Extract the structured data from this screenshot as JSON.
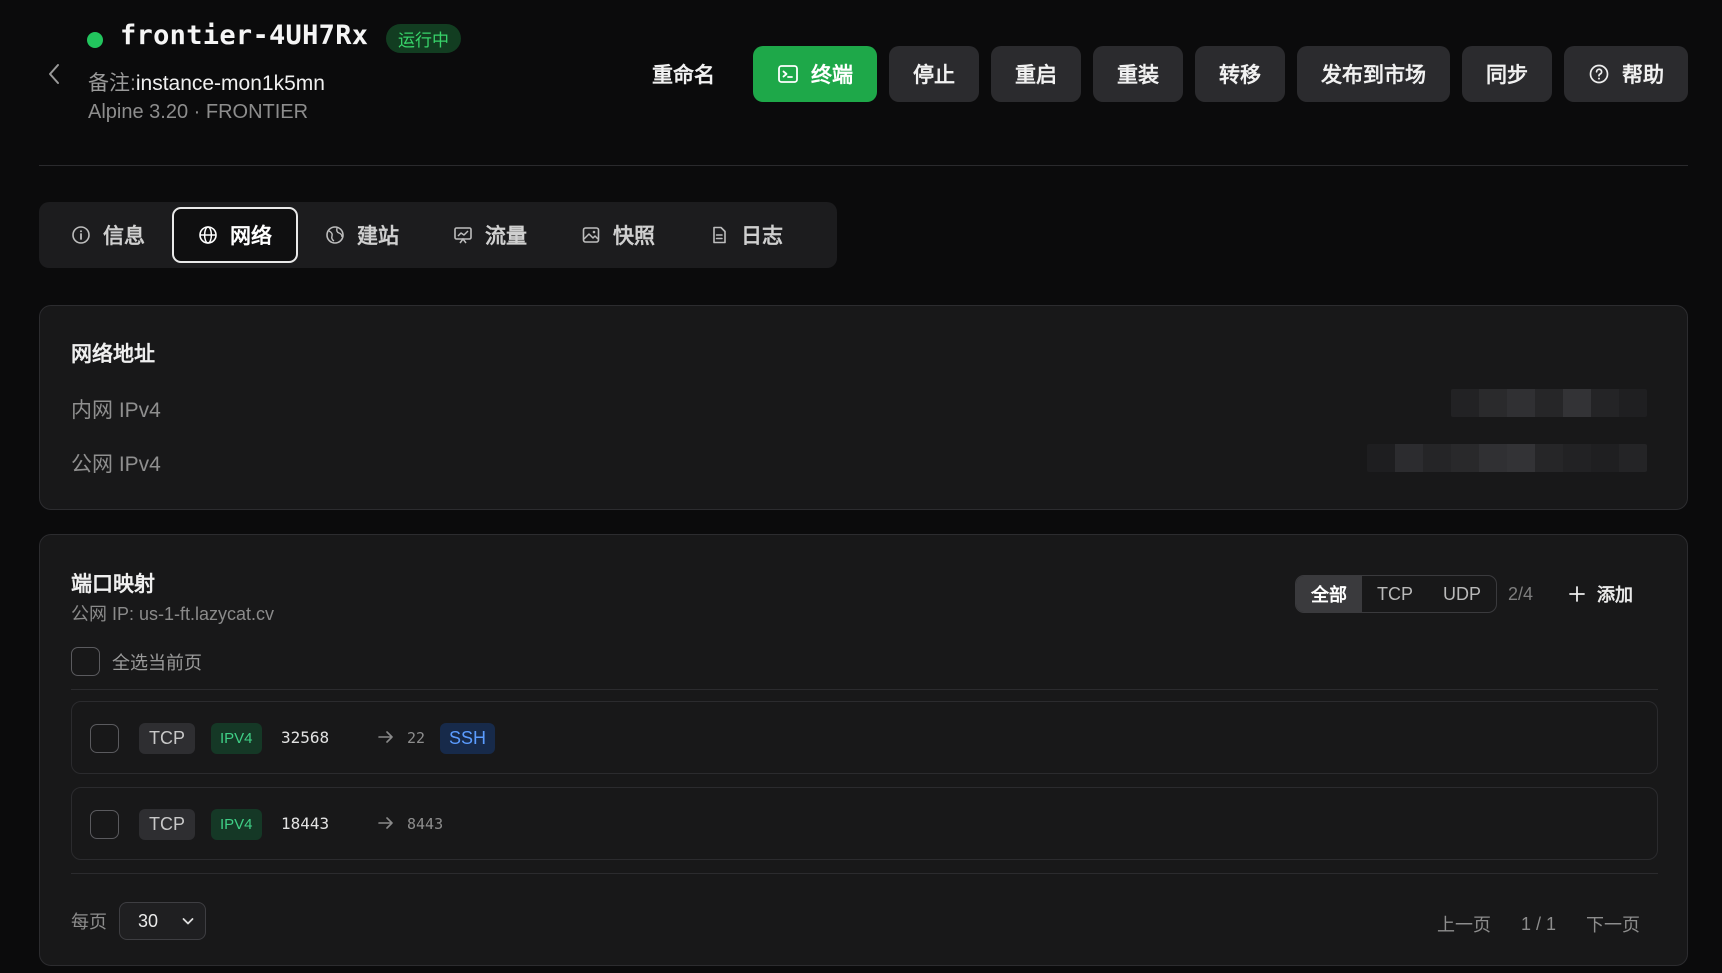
{
  "header": {
    "instance_name": "frontier-4UH7Rx",
    "status": "运行中",
    "remark_label": "备注:",
    "remark_value": "instance-mon1k5mn",
    "os_line": "Alpine 3.20 · FRONTIER",
    "actions": {
      "rename": "重命名",
      "terminal": "终端",
      "stop": "停止",
      "restart": "重启",
      "reinstall": "重装",
      "transfer": "转移",
      "publish": "发布到市场",
      "sync": "同步",
      "help": "帮助"
    }
  },
  "tabs": [
    {
      "label": "信息",
      "icon": "info-icon",
      "active": false
    },
    {
      "label": "网络",
      "icon": "globe-icon",
      "active": true
    },
    {
      "label": "建站",
      "icon": "web-icon",
      "active": false
    },
    {
      "label": "流量",
      "icon": "chart-icon",
      "active": false
    },
    {
      "label": "快照",
      "icon": "image-icon",
      "active": false
    },
    {
      "label": "日志",
      "icon": "file-icon",
      "active": false
    }
  ],
  "network_address": {
    "title": "网络地址",
    "private_label": "内网 IPv4",
    "public_label": "公网 IPv4"
  },
  "port_mapping": {
    "title": "端口映射",
    "public_ip": "公网 IP: us-1-ft.lazycat.cv",
    "filters": [
      "全部",
      "TCP",
      "UDP"
    ],
    "active_filter": "全部",
    "count": "2/4",
    "add_label": "添加",
    "select_all_label": "全选当前页",
    "rows": [
      {
        "protocol": "TCP",
        "ip_version": "IPV4",
        "public_port": "32568",
        "private_port": "22",
        "service": "SSH"
      },
      {
        "protocol": "TCP",
        "ip_version": "IPV4",
        "public_port": "18443",
        "private_port": "8443",
        "service": ""
      }
    ],
    "per_page_label": "每页",
    "per_page_value": "30",
    "prev_label": "上一页",
    "page_indicator": "1 / 1",
    "next_label": "下一页"
  },
  "colors": {
    "accent_green": "#1ea849",
    "status_green": "#22c55e",
    "ssh_blue": "#5b9cff"
  }
}
